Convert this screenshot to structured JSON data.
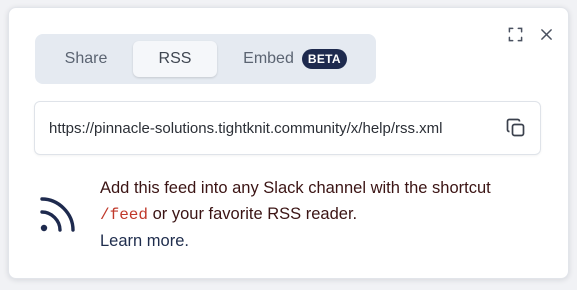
{
  "tabs": [
    {
      "label": "Share"
    },
    {
      "label": "RSS",
      "selected": true
    },
    {
      "label": "Embed",
      "badge": "BETA"
    }
  ],
  "feed": {
    "url": "https://pinnacle-solutions.tightknit.community/x/help/rss.xml"
  },
  "description": {
    "text_before": "Add this feed into any Slack channel with the shortcut",
    "shortcut": "/feed",
    "text_after": " or your favorite RSS reader.",
    "learn_more": "Learn more."
  },
  "icons": {
    "expand": "expand-icon",
    "close": "close-icon",
    "copy": "copy-icon",
    "rss": "rss-icon"
  },
  "colors": {
    "badge_bg": "#1e2a4e",
    "shortcut": "#c0392b",
    "description_text": "#3b1414",
    "rss_icon": "#1e2a4e"
  }
}
